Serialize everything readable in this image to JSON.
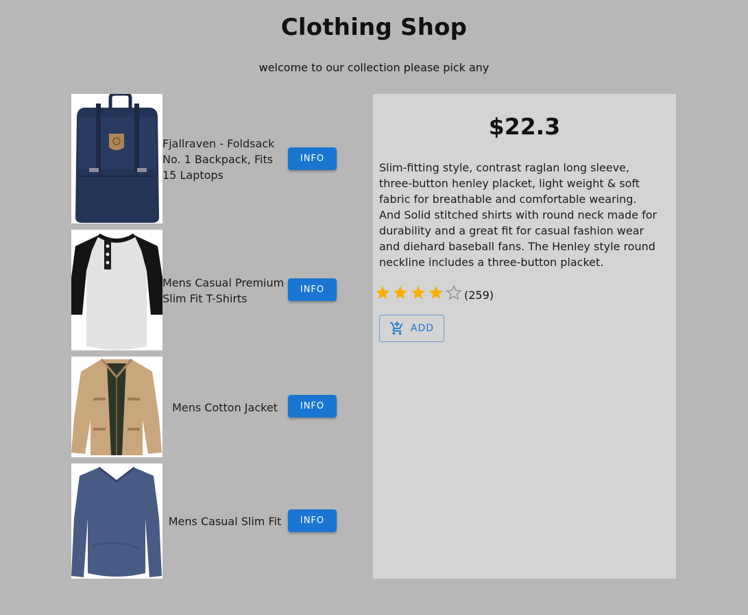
{
  "header": {
    "title": "Clothing Shop",
    "subtitle": "welcome to our collection please pick any"
  },
  "products": [
    {
      "name": "Fjallraven - Foldsack No. 1 Backpack, Fits 15 Laptops",
      "button": "INFO",
      "image": "backpack"
    },
    {
      "name": "Mens Casual Premium Slim Fit T-Shirts",
      "button": "INFO",
      "image": "raglan-shirt"
    },
    {
      "name": "Mens Cotton Jacket",
      "button": "INFO",
      "image": "cotton-jacket"
    },
    {
      "name": "Mens Casual Slim Fit",
      "button": "INFO",
      "image": "long-sleeve-shirt"
    }
  ],
  "detail": {
    "price": "$22.3",
    "description": "Slim-fitting style, contrast raglan long sleeve, three-button henley placket, light weight & soft fabric for breathable and comfortable wearing. And Solid stitched shirts with round neck made for durability and a great fit for casual fashion wear and diehard baseball fans. The Henley style round neckline includes a three-button placket.",
    "rating": 4,
    "rating_max": 5,
    "rating_count": "(259)",
    "add_label": "ADD",
    "add_icon": "add-shopping-cart-icon"
  },
  "colors": {
    "page_bg": "#b7b7b7",
    "panel_bg": "#d4d4d4",
    "primary": "#1976d2",
    "star": "#faaf00"
  }
}
